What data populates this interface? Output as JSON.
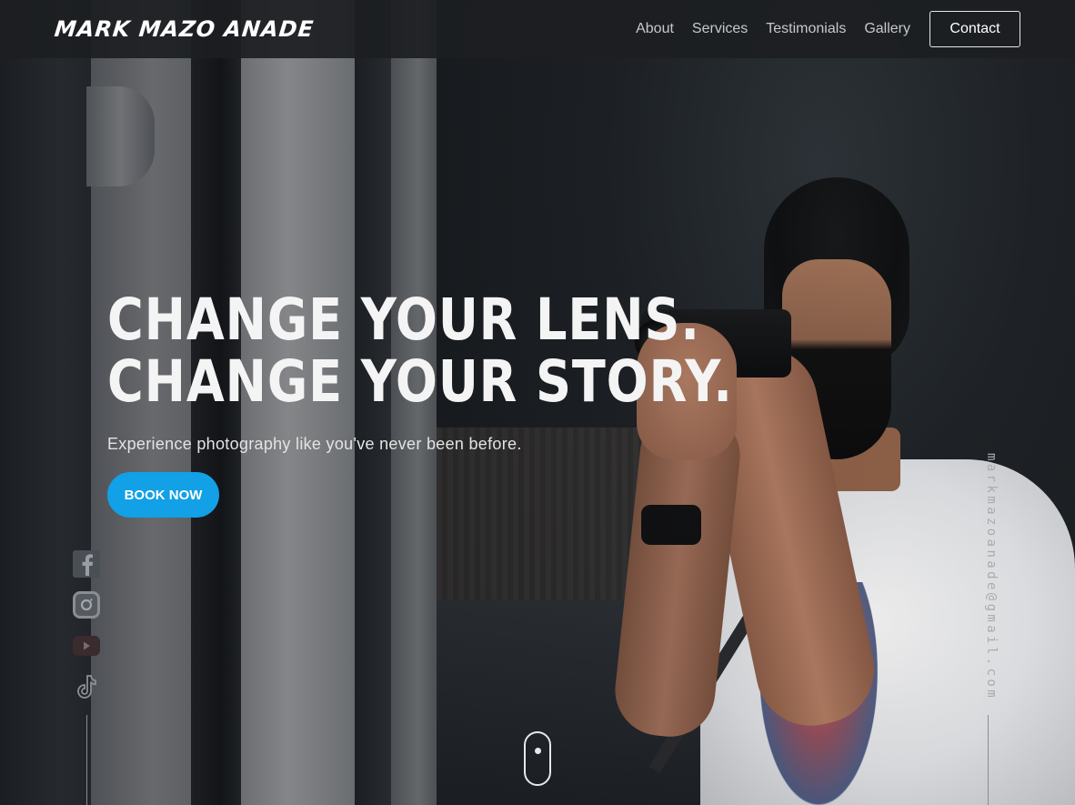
{
  "header": {
    "logo": "MARK MAZO ANADE",
    "nav": [
      "About",
      "Services",
      "Testimonials",
      "Gallery"
    ],
    "contact_label": "Contact"
  },
  "hero": {
    "headline_line1": "CHANGE YOUR LENS.",
    "headline_line2": "CHANGE YOUR STORY.",
    "subline": "Experience photography like you've never been before.",
    "cta_label": "BOOK NOW"
  },
  "social": {
    "icons": [
      "facebook-icon",
      "instagram-icon",
      "youtube-icon",
      "tiktok-icon"
    ]
  },
  "email": "markmazoanade@gmail.com",
  "colors": {
    "accent": "#12a0e6",
    "header_bg": "#1c1e22"
  }
}
